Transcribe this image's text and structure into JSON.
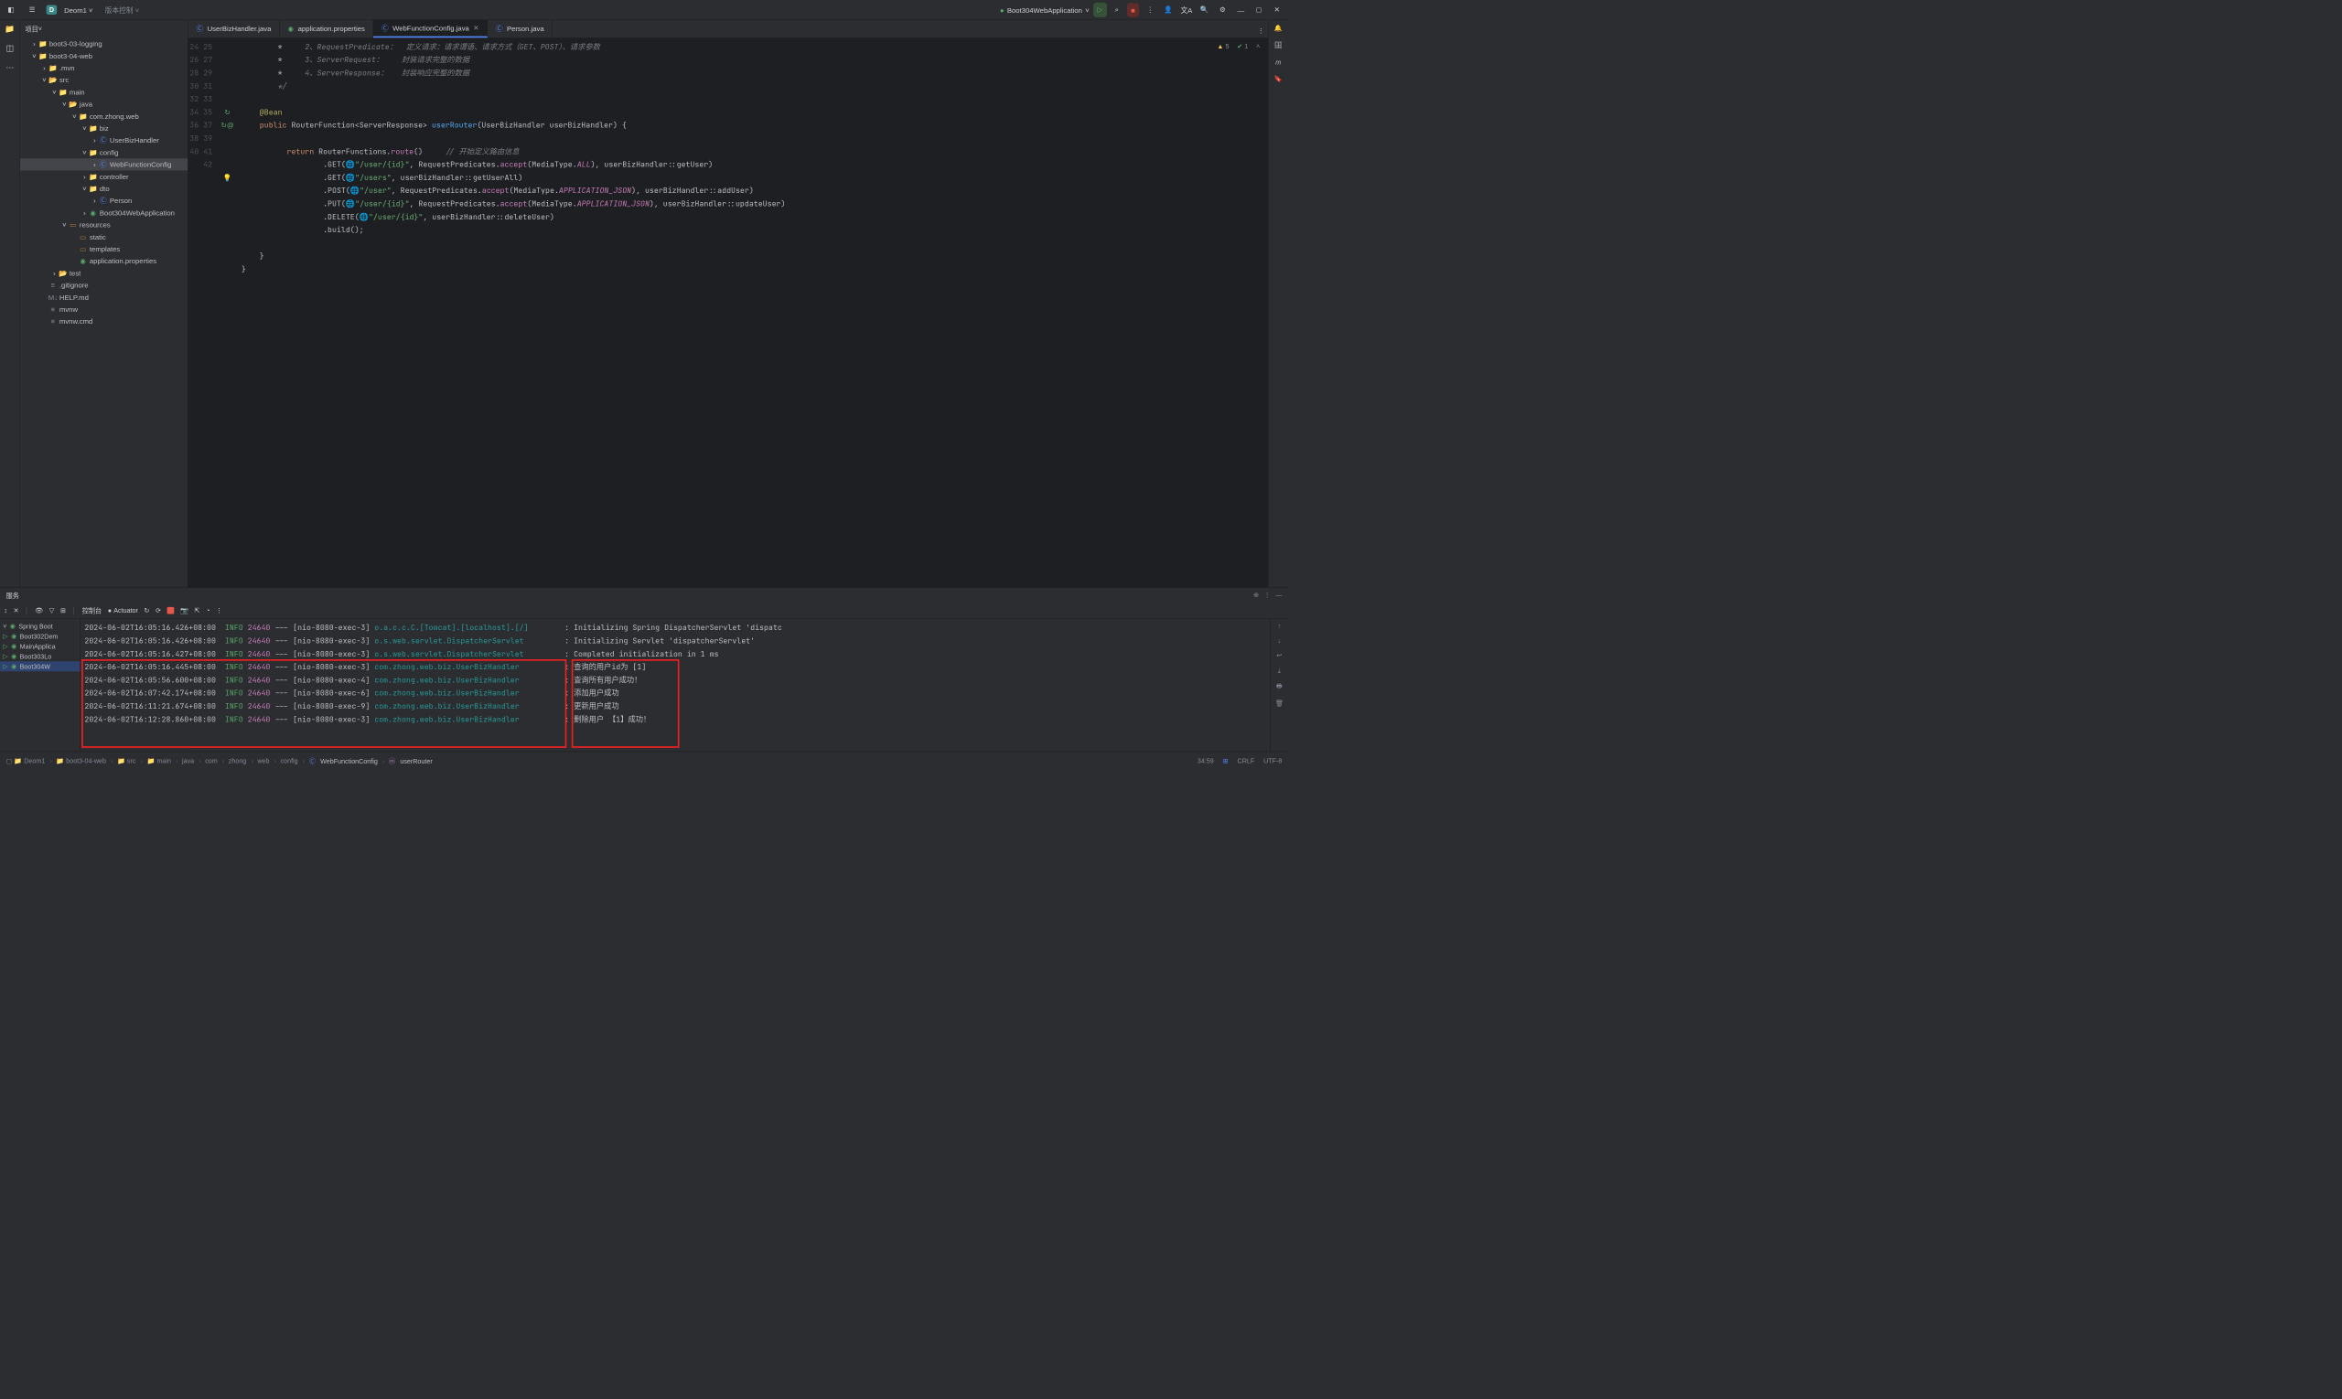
{
  "titlebar": {
    "project_badge": "D",
    "project_name": "Deom1",
    "vcs": "版本控制",
    "run_config": "Boot304WebApplication"
  },
  "sidebar": {
    "header": "项目",
    "tree": [
      {
        "depth": 1,
        "arrow": ">",
        "icon": "folder",
        "label": "boot3-03-logging"
      },
      {
        "depth": 1,
        "arrow": "v",
        "icon": "folder",
        "label": "boot3-04-web"
      },
      {
        "depth": 2,
        "arrow": ">",
        "icon": "folder",
        "label": ".mvn"
      },
      {
        "depth": 2,
        "arrow": "v",
        "icon": "src",
        "label": "src"
      },
      {
        "depth": 3,
        "arrow": "v",
        "icon": "folder",
        "label": "main"
      },
      {
        "depth": 4,
        "arrow": "v",
        "icon": "src",
        "label": "java"
      },
      {
        "depth": 5,
        "arrow": "v",
        "icon": "pkg",
        "label": "com.zhong.web"
      },
      {
        "depth": 6,
        "arrow": "v",
        "icon": "pkg",
        "label": "biz"
      },
      {
        "depth": 7,
        "arrow": ">",
        "icon": "class",
        "label": "UserBizHandler"
      },
      {
        "depth": 6,
        "arrow": "v",
        "icon": "pkg",
        "label": "config"
      },
      {
        "depth": 7,
        "arrow": ">",
        "icon": "class",
        "label": "WebFunctionConfig",
        "selected": true
      },
      {
        "depth": 6,
        "arrow": ">",
        "icon": "pkg",
        "label": "controller"
      },
      {
        "depth": 6,
        "arrow": "v",
        "icon": "pkg",
        "label": "dto"
      },
      {
        "depth": 7,
        "arrow": ">",
        "icon": "class",
        "label": "Person"
      },
      {
        "depth": 6,
        "arrow": ">",
        "icon": "spring",
        "label": "Boot304WebApplication"
      },
      {
        "depth": 4,
        "arrow": "v",
        "icon": "res",
        "label": "resources"
      },
      {
        "depth": 5,
        "arrow": "",
        "icon": "res",
        "label": "static"
      },
      {
        "depth": 5,
        "arrow": "",
        "icon": "res",
        "label": "templates"
      },
      {
        "depth": 5,
        "arrow": "",
        "icon": "spring",
        "label": "application.properties"
      },
      {
        "depth": 3,
        "arrow": ">",
        "icon": "src",
        "label": "test"
      },
      {
        "depth": 2,
        "arrow": "",
        "icon": "file",
        "label": ".gitignore"
      },
      {
        "depth": 2,
        "arrow": "",
        "icon": "md",
        "label": "HELP.md"
      },
      {
        "depth": 2,
        "arrow": "",
        "icon": "file",
        "label": "mvnw"
      },
      {
        "depth": 2,
        "arrow": "",
        "icon": "file",
        "label": "mvnw.cmd"
      }
    ]
  },
  "tabs": [
    {
      "icon": "class",
      "label": "UserBizHandler.java"
    },
    {
      "icon": "spring",
      "label": "application.properties"
    },
    {
      "icon": "class",
      "label": "WebFunctionConfig.java",
      "active": true,
      "close": true
    },
    {
      "icon": "class",
      "label": "Person.java"
    }
  ],
  "editor_hints": {
    "warn": "5",
    "ok": "1"
  },
  "gutter": [
    "24",
    "25",
    "26",
    "27",
    "28",
    "29",
    "30",
    "31",
    "32",
    "33",
    "34",
    "35",
    "36",
    "37",
    "38",
    "39",
    "40",
    "41",
    "42"
  ],
  "code_html": "        *     <span class='c-comment'>2、RequestPredicate：  定义请求：请求谓语、请求方式（GET、POST）、请求参数</span>\n        *     <span class='c-comment'>3、ServerRequest：    封装请求完整的数据</span>\n        *     <span class='c-comment'>4、ServerResponse：   封装响应完整的数据</span>\n        <span class='c-comment'>*/</span>\n\n    <span class='c-anno'>@Bean</span>\n    <span class='c-kw'>public</span> <span class='c-type'>RouterFunction&lt;ServerResponse&gt;</span> <span class='c-method'>userRouter</span>(UserBizHandler userBizHandler) {\n\n          <span class='c-kw'>return</span> RouterFunctions.<span class='c-id'>route</span>()     <span class='c-comment'>// 开始定义路由信息</span>\n                  .GET(🌐<span class='c-str'>\"/user/{id}\"</span>, RequestPredicates.<span class='c-id'>accept</span>(MediaType.<span class='c-const'>ALL</span>), userBizHandler::getUser)\n                  .GET(🌐<span class='c-str'>\"/users\"</span>, userBizHandler::getUserAll)\n                  .POST(🌐<span class='c-str'>\"/user\"</span>, RequestPredicates.<span class='c-id'>accept</span>(MediaType.<span class='c-const'>APPLICATION_JSON</span>), userBizHandler::addUser)\n                  .PUT(🌐<span class='c-str'>\"/user/{id}\"</span>, RequestPredicates.<span class='c-id'>accept</span>(MediaType.<span class='c-const'>APPLICATION_JSON</span>), userBizHandler::updateUser)\n                  .DELETE(🌐<span class='c-str'>\"/user/{id}\"</span>, userBizHandler::deleteUser)\n                  .build();\n\n    }\n}\n",
  "services": {
    "title": "服务",
    "toolbar": {
      "console": "控制台",
      "actuator": "Actuator"
    },
    "tree": [
      {
        "label": "Spring Boot",
        "icon": "spring",
        "arrow": "v"
      },
      {
        "label": "Boot302Dem",
        "icon": "spring",
        "run": true
      },
      {
        "label": "MainApplica",
        "icon": "spring",
        "run": true
      },
      {
        "label": "Boot303Lo",
        "icon": "spring",
        "run": true
      },
      {
        "label": "Boot304W",
        "icon": "spring",
        "run": true,
        "sel": true
      }
    ],
    "log": [
      {
        "ts": "2024-06-02T16:05:16.426+08:00",
        "lvl": "INFO",
        "pid": "24640",
        "thread": "[nio-8080-exec-3]",
        "cls": "o.a.c.c.C.[Tomcat].[localhost].[/]",
        "msg": "Initializing Spring DispatcherServlet 'dispatc"
      },
      {
        "ts": "2024-06-02T16:05:16.426+08:00",
        "lvl": "INFO",
        "pid": "24640",
        "thread": "[nio-8080-exec-3]",
        "cls": "o.s.web.servlet.DispatcherServlet",
        "msg": "Initializing Servlet 'dispatcherServlet'"
      },
      {
        "ts": "2024-06-02T16:05:16.427+08:00",
        "lvl": "INFO",
        "pid": "24640",
        "thread": "[nio-8080-exec-3]",
        "cls": "o.s.web.servlet.DispatcherServlet",
        "msg": "Completed initialization in 1 ms"
      },
      {
        "ts": "2024-06-02T16:05:16.445+08:00",
        "lvl": "INFO",
        "pid": "24640",
        "thread": "[nio-8080-exec-3]",
        "cls": "com.zhong.web.biz.UserBizHandler",
        "msg": "查询的用户id为 [1]"
      },
      {
        "ts": "2024-06-02T16:05:56.600+08:00",
        "lvl": "INFO",
        "pid": "24640",
        "thread": "[nio-8080-exec-4]",
        "cls": "com.zhong.web.biz.UserBizHandler",
        "msg": "查询所有用户成功！"
      },
      {
        "ts": "2024-06-02T16:07:42.174+08:00",
        "lvl": "INFO",
        "pid": "24640",
        "thread": "[nio-8080-exec-6]",
        "cls": "com.zhong.web.biz.UserBizHandler",
        "msg": "添加用户成功"
      },
      {
        "ts": "2024-06-02T16:11:21.674+08:00",
        "lvl": "INFO",
        "pid": "24640",
        "thread": "[nio-8080-exec-9]",
        "cls": "com.zhong.web.biz.UserBizHandler",
        "msg": "更新用户成功"
      },
      {
        "ts": "2024-06-02T16:12:28.860+08:00",
        "lvl": "INFO",
        "pid": "24640",
        "thread": "[nio-8080-exec-3]",
        "cls": "com.zhong.web.biz.UserBizHandler",
        "msg": "删除用户 【1】成功！"
      }
    ]
  },
  "breadcrumb": [
    "Deom1",
    "boot3-04-web",
    "src",
    "main",
    "java",
    "com",
    "zhong",
    "web",
    "config",
    "WebFunctionConfig",
    "userRouter"
  ],
  "status": {
    "pos": "34:59",
    "os": "CRLF",
    "enc": "UTF-8"
  }
}
